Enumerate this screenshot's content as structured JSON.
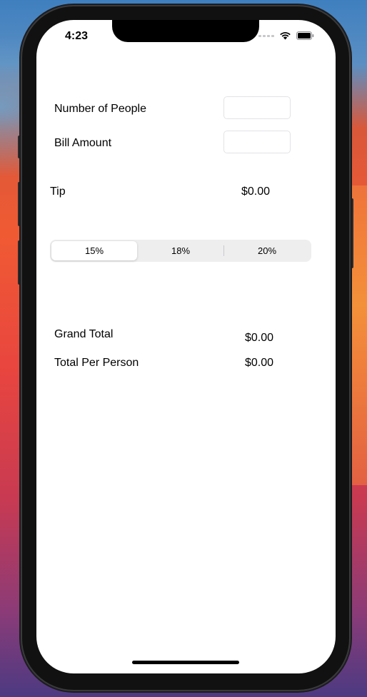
{
  "status_bar": {
    "time": "4:23",
    "icons": [
      "cellular-icon",
      "wifi-icon",
      "battery-icon"
    ]
  },
  "form": {
    "people_label": "Number of People",
    "people_value": "",
    "bill_label": "Bill Amount",
    "bill_value": ""
  },
  "tip": {
    "label": "Tip",
    "value": "$0.00",
    "options": [
      "15%",
      "18%",
      "20%"
    ],
    "selected": "15%"
  },
  "totals": {
    "grand_label": "Grand Total",
    "grand_value": "$0.00",
    "per_person_label": "Total Per Person",
    "per_person_value": "$0.00"
  },
  "colors": {
    "screen_bg": "#ffffff",
    "segment_bg": "#eeeeef",
    "segment_selected": "#ffffff",
    "text": "#000000"
  }
}
